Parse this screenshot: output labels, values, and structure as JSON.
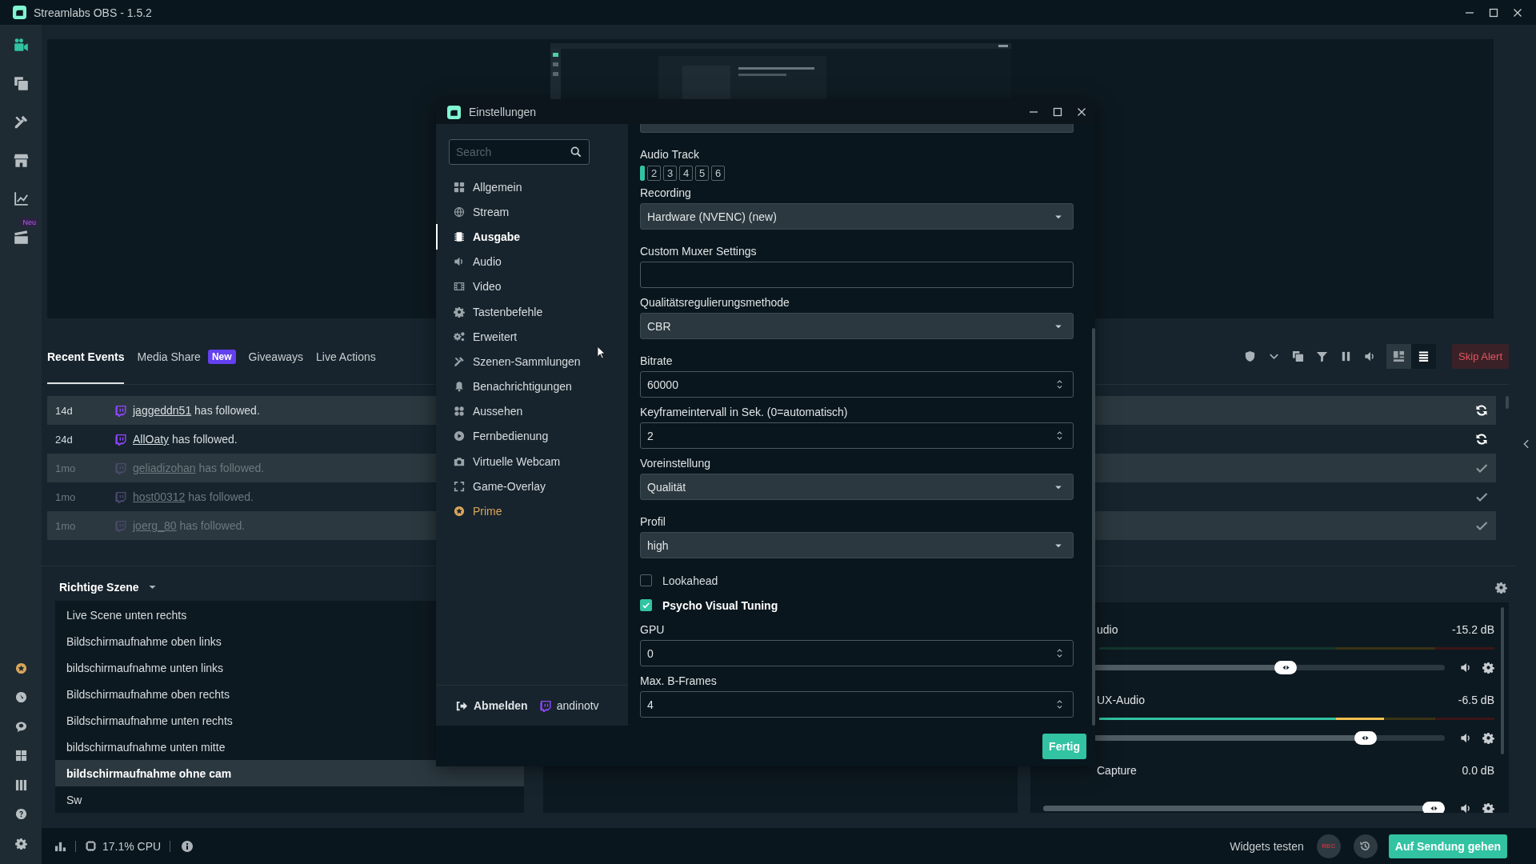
{
  "window": {
    "title": "Streamlabs OBS - 1.5.2"
  },
  "nav_rail": {
    "items": [
      {
        "selected": true
      },
      {
        "selected": false
      },
      {
        "selected": false
      },
      {
        "selected": false
      },
      {
        "selected": false
      },
      {
        "selected": false,
        "badge": "Neu"
      }
    ]
  },
  "events": {
    "tabs": [
      {
        "label": "Recent Events",
        "selected": true
      },
      {
        "label": "Media Share",
        "selected": false,
        "badge": "New"
      },
      {
        "label": "Giveaways",
        "selected": false
      },
      {
        "label": "Live Actions",
        "selected": false
      }
    ],
    "layout_modes": [
      {
        "selected": false
      },
      {
        "selected": true
      }
    ],
    "skip_button": "Skip Alert",
    "rows": [
      {
        "time": "14d",
        "user": "jaggeddn51",
        "text": "has followed.",
        "seen": false
      },
      {
        "time": "24d",
        "user": "AllOaty",
        "text": "has followed.",
        "seen": false
      },
      {
        "time": "1mo",
        "user": "geliadizohan",
        "text": "has followed.",
        "seen": true
      },
      {
        "time": "1mo",
        "user": "host00312",
        "text": "has followed.",
        "seen": true
      },
      {
        "time": "1mo",
        "user": "joerg_80",
        "text": "has followed.",
        "seen": true
      }
    ]
  },
  "scenes": {
    "collection": "Richtige Szene",
    "items": [
      {
        "name": "Live Scene unten rechts",
        "selected": false
      },
      {
        "name": "Bildschirmaufnahme oben links",
        "selected": false
      },
      {
        "name": "bildschirmaufnahme unten links",
        "selected": false
      },
      {
        "name": "Bildschirmaufnahme oben rechts",
        "selected": false
      },
      {
        "name": "Bildschirmaufnahme unten rechts",
        "selected": false
      },
      {
        "name": "bildschirmaufnahme unten mitte",
        "selected": false
      },
      {
        "name": "bildschirmaufnahme ohne cam",
        "selected": true
      },
      {
        "name": "Sw",
        "selected": false
      }
    ]
  },
  "mixer": {
    "sources": [
      {
        "name": "udio",
        "reading": "-15.2 dB",
        "meter": {
          "level": 0
        },
        "volume": {
          "level": 0.61
        }
      },
      {
        "name": "UX-Audio",
        "reading": "-6.5 dB",
        "meter": {
          "level": 0.72
        },
        "volume": {
          "level": 0.82
        }
      },
      {
        "name": "Capture",
        "reading": "0.0 dB",
        "volume": {
          "level": 1
        }
      }
    ]
  },
  "status_bar": {
    "cpu": "17.1% CPU",
    "test_widgets": "Widgets testen",
    "rec": "REC",
    "go_live": "Auf Sendung gehen"
  },
  "settings_dialog": {
    "title": "Einstellungen",
    "search": {
      "placeholder": "Search"
    },
    "nav": [
      {
        "label": "Allgemein",
        "selected": false,
        "kind": "section"
      },
      {
        "label": "Stream",
        "selected": false,
        "kind": "section"
      },
      {
        "label": "Ausgabe",
        "selected": true,
        "kind": "section"
      },
      {
        "label": "Audio",
        "selected": false,
        "kind": "section"
      },
      {
        "label": "Video",
        "selected": false,
        "kind": "section"
      },
      {
        "label": "Tastenbefehle",
        "selected": false,
        "kind": "section"
      },
      {
        "label": "Erweitert",
        "selected": false,
        "kind": "section"
      },
      {
        "label": "Szenen-Sammlungen",
        "selected": false,
        "kind": "section"
      },
      {
        "label": "Benachrichtigungen",
        "selected": false,
        "kind": "section"
      },
      {
        "label": "Aussehen",
        "selected": false,
        "kind": "section"
      },
      {
        "label": "Fernbedienung",
        "selected": false,
        "kind": "section"
      },
      {
        "label": "Virtuelle Webcam",
        "selected": false,
        "kind": "section"
      },
      {
        "label": "Game-Overlay",
        "selected": false,
        "kind": "section"
      },
      {
        "label": "Prime",
        "selected": false,
        "kind": "premium"
      }
    ],
    "logout": "Abmelden",
    "account": "andinotv",
    "fields": [
      {
        "kind": "clipped-select"
      },
      {
        "kind": "tracks",
        "label": "Audio Track",
        "tracks": [
          {
            "selected": true
          },
          {
            "label": "2",
            "selected": false
          },
          {
            "label": "3",
            "selected": false
          },
          {
            "label": "4",
            "selected": false
          },
          {
            "label": "5",
            "selected": false
          },
          {
            "label": "6",
            "selected": false
          }
        ]
      },
      {
        "kind": "select",
        "label": "Recording",
        "value": "Hardware (NVENC) (new)"
      },
      {
        "kind": "text",
        "label": "Custom Muxer Settings"
      },
      {
        "kind": "select",
        "label": "Qualitätsregulierungsmethode",
        "value": "CBR"
      },
      {
        "kind": "number",
        "label": "Bitrate",
        "value": "60000"
      },
      {
        "kind": "number",
        "label": "Keyframeintervall in Sek. (0=automatisch)",
        "value": "2"
      },
      {
        "kind": "select",
        "label": "Voreinstellung",
        "value": "Qualität"
      },
      {
        "kind": "select",
        "label": "Profil",
        "value": "high"
      },
      {
        "kind": "checkbox",
        "label": "Lookahead",
        "checked": false
      },
      {
        "kind": "checkbox",
        "label": "Psycho Visual Tuning",
        "checked": true
      },
      {
        "kind": "number",
        "label": "GPU",
        "value": "0"
      },
      {
        "kind": "number",
        "label": "Max. B-Frames",
        "value": "4"
      }
    ],
    "done_button": "Fertig"
  }
}
